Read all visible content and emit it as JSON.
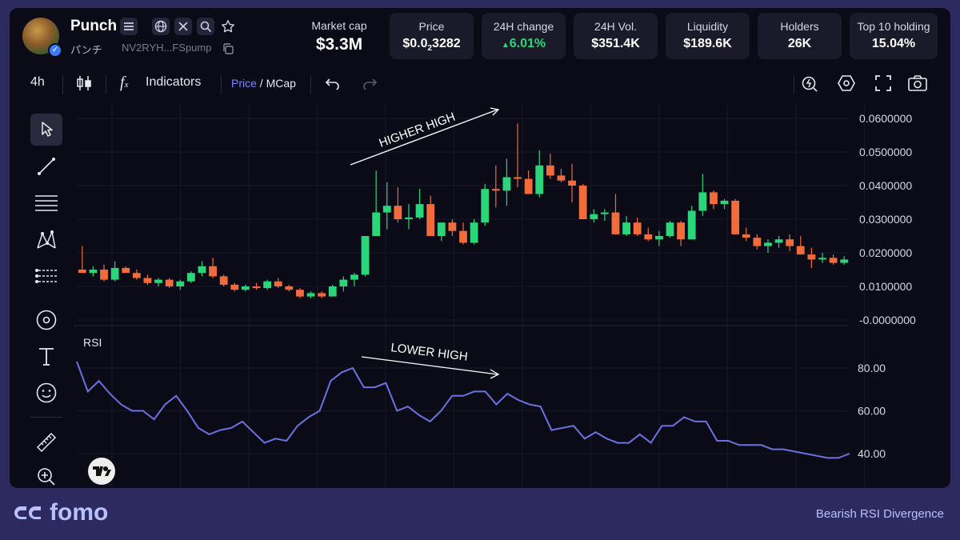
{
  "token": {
    "name": "Punch",
    "sub": "パンチ",
    "address": "NV2RYH...FSpump"
  },
  "stats": {
    "market_cap": {
      "label": "Market cap",
      "value": "$3.3M"
    },
    "price": {
      "label": "Price",
      "value_prefix": "$0.0",
      "value_sub": "2",
      "value_suffix": "3282"
    },
    "change": {
      "label": "24H change",
      "value": "6.01%"
    },
    "volume": {
      "label": "24H Vol.",
      "value": "$351.4K"
    },
    "liquidity": {
      "label": "Liquidity",
      "value": "$189.6K"
    },
    "holders": {
      "label": "Holders",
      "value": "26K"
    },
    "top10": {
      "label": "Top 10 holding",
      "value": "15.04%"
    }
  },
  "toolbar": {
    "interval": "4h",
    "indicators": "Indicators",
    "price": "Price",
    "slash": " / ",
    "mcap": "MCap"
  },
  "icons": {
    "menu": "menu-icon",
    "web": "globe-icon",
    "x": "x-icon",
    "search": "search-icon",
    "star": "star-icon",
    "copy": "copy-icon",
    "candles": "candles-icon",
    "fx": "fx-icon",
    "undo": "undo-icon",
    "redo": "redo-icon",
    "replay": "replay-icon",
    "settings": "hexagon-settings-icon",
    "fullscreen": "fullscreen-icon",
    "camera": "camera-icon",
    "cursor": "cursor-icon",
    "trendline": "trendline-icon",
    "fib": "fib-icon",
    "pattern": "pattern-icon",
    "forecast": "forecast-icon",
    "brush": "brush-icon",
    "text": "text-icon",
    "emoji": "emoji-icon",
    "ruler": "ruler-icon",
    "zoom": "zoom-in-icon"
  },
  "colors": {
    "up": "#2bd67b",
    "down": "#f26b3a",
    "rsi": "#6b72e0",
    "accent": "#7b86ff",
    "panel": "#0b0b18"
  },
  "annotations": {
    "price": "HIGHER HIGH",
    "rsi": "LOWER HIGH"
  },
  "footer": {
    "brand": "fomo",
    "note": "Bearish RSI Divergence"
  },
  "chart_data": [
    {
      "type": "candlestick",
      "y_ticks": [
        "0.0600000",
        "0.0500000",
        "0.0400000",
        "0.0300000",
        "0.0200000",
        "0.0100000",
        "-0.0000000"
      ],
      "ylim": [
        0,
        0.06
      ],
      "candles": [
        [
          0.015,
          0.022,
          0.014,
          0.014
        ],
        [
          0.014,
          0.016,
          0.013,
          0.015
        ],
        [
          0.015,
          0.0165,
          0.0115,
          0.012
        ],
        [
          0.012,
          0.0175,
          0.0115,
          0.0155
        ],
        [
          0.0155,
          0.016,
          0.014,
          0.014
        ],
        [
          0.014,
          0.015,
          0.012,
          0.0125
        ],
        [
          0.0125,
          0.0135,
          0.0105,
          0.011
        ],
        [
          0.011,
          0.0125,
          0.01,
          0.012
        ],
        [
          0.012,
          0.0125,
          0.0095,
          0.01
        ],
        [
          0.01,
          0.012,
          0.009,
          0.0115
        ],
        [
          0.0115,
          0.0145,
          0.011,
          0.014
        ],
        [
          0.014,
          0.0175,
          0.013,
          0.016
        ],
        [
          0.016,
          0.0185,
          0.0125,
          0.013
        ],
        [
          0.013,
          0.0135,
          0.01,
          0.0105
        ],
        [
          0.0105,
          0.011,
          0.0085,
          0.009
        ],
        [
          0.009,
          0.0105,
          0.0085,
          0.01
        ],
        [
          0.01,
          0.011,
          0.009,
          0.0095
        ],
        [
          0.0095,
          0.012,
          0.009,
          0.0115
        ],
        [
          0.0115,
          0.0125,
          0.0095,
          0.01
        ],
        [
          0.01,
          0.0105,
          0.0085,
          0.009
        ],
        [
          0.009,
          0.0095,
          0.0065,
          0.007
        ],
        [
          0.007,
          0.0085,
          0.0065,
          0.008
        ],
        [
          0.008,
          0.0085,
          0.0065,
          0.007
        ],
        [
          0.007,
          0.0105,
          0.007,
          0.01
        ],
        [
          0.01,
          0.013,
          0.0085,
          0.012
        ],
        [
          0.012,
          0.014,
          0.01,
          0.0135
        ],
        [
          0.0135,
          0.025,
          0.013,
          0.025
        ],
        [
          0.025,
          0.0445,
          0.025,
          0.032
        ],
        [
          0.032,
          0.041,
          0.027,
          0.034
        ],
        [
          0.034,
          0.0395,
          0.029,
          0.03
        ],
        [
          0.03,
          0.0345,
          0.027,
          0.0305
        ],
        [
          0.0305,
          0.039,
          0.03,
          0.0345
        ],
        [
          0.0345,
          0.037,
          0.025,
          0.025
        ],
        [
          0.025,
          0.0285,
          0.0235,
          0.029
        ],
        [
          0.029,
          0.03,
          0.025,
          0.0265
        ],
        [
          0.0265,
          0.029,
          0.0225,
          0.023
        ],
        [
          0.023,
          0.03,
          0.0225,
          0.029
        ],
        [
          0.029,
          0.0405,
          0.028,
          0.039
        ],
        [
          0.039,
          0.046,
          0.0335,
          0.0385
        ],
        [
          0.0385,
          0.048,
          0.034,
          0.0425
        ],
        [
          0.0425,
          0.0585,
          0.0395,
          0.042
        ],
        [
          0.042,
          0.0445,
          0.04,
          0.0375
        ],
        [
          0.0375,
          0.0505,
          0.0365,
          0.046
        ],
        [
          0.046,
          0.0495,
          0.042,
          0.043
        ],
        [
          0.043,
          0.045,
          0.041,
          0.0415
        ],
        [
          0.0415,
          0.0465,
          0.035,
          0.04
        ],
        [
          0.04,
          0.0405,
          0.03,
          0.03
        ],
        [
          0.03,
          0.033,
          0.029,
          0.0315
        ],
        [
          0.0315,
          0.033,
          0.0295,
          0.032
        ],
        [
          0.032,
          0.0375,
          0.0255,
          0.0255
        ],
        [
          0.0255,
          0.031,
          0.025,
          0.029
        ],
        [
          0.029,
          0.0305,
          0.025,
          0.0255
        ],
        [
          0.0255,
          0.0275,
          0.0235,
          0.024
        ],
        [
          0.024,
          0.0265,
          0.022,
          0.025
        ],
        [
          0.025,
          0.0295,
          0.0245,
          0.029
        ],
        [
          0.029,
          0.0295,
          0.022,
          0.024
        ],
        [
          0.024,
          0.034,
          0.024,
          0.0325
        ],
        [
          0.0325,
          0.0435,
          0.031,
          0.038
        ],
        [
          0.038,
          0.0385,
          0.033,
          0.0345
        ],
        [
          0.0345,
          0.036,
          0.033,
          0.0355
        ],
        [
          0.0355,
          0.036,
          0.0255,
          0.0255
        ],
        [
          0.0255,
          0.0275,
          0.0235,
          0.0245
        ],
        [
          0.0245,
          0.0255,
          0.021,
          0.022
        ],
        [
          0.022,
          0.024,
          0.02,
          0.023
        ],
        [
          0.023,
          0.025,
          0.0215,
          0.024
        ],
        [
          0.024,
          0.0255,
          0.0205,
          0.022
        ],
        [
          0.022,
          0.025,
          0.0195,
          0.0195
        ],
        [
          0.0195,
          0.0215,
          0.0155,
          0.018
        ],
        [
          0.018,
          0.02,
          0.017,
          0.0185
        ],
        [
          0.0185,
          0.0195,
          0.0165,
          0.017
        ],
        [
          0.017,
          0.019,
          0.0165,
          0.018
        ]
      ]
    },
    {
      "type": "line",
      "title": "RSI",
      "y_ticks": [
        "80.00",
        "60.00",
        "40.00"
      ],
      "ylim": [
        33,
        92
      ],
      "values": [
        83,
        69,
        74,
        68,
        63,
        60,
        60,
        56,
        63,
        67,
        60,
        52,
        49,
        51,
        52,
        55,
        50,
        45,
        47,
        46,
        53,
        57,
        60,
        74,
        78,
        80,
        71,
        71,
        73,
        60,
        62,
        58,
        55,
        60,
        67,
        67,
        69,
        69,
        63,
        68,
        65,
        63,
        62,
        51,
        52,
        53,
        47,
        50,
        47,
        45,
        45,
        49,
        45,
        53,
        53,
        57,
        55,
        55,
        46,
        46,
        44,
        44,
        44,
        42,
        42,
        41,
        40,
        39,
        38,
        38,
        40
      ]
    }
  ]
}
